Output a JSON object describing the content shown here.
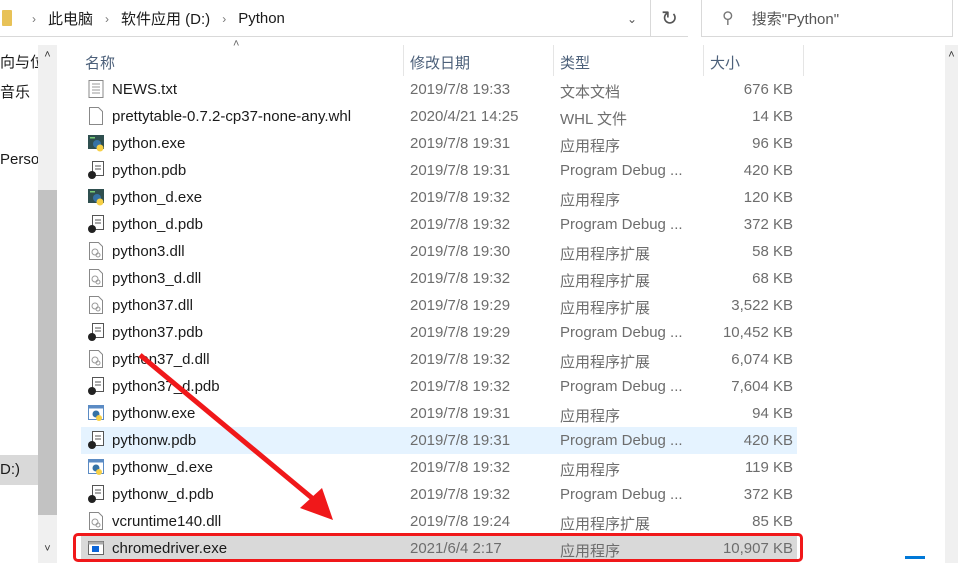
{
  "address": {
    "crumbs": [
      "此电脑",
      "软件应用 (D:)",
      "Python"
    ]
  },
  "search": {
    "placeholder": "搜索\"Python\""
  },
  "sidebar": {
    "items": [
      "向与位",
      "音乐",
      "Perso",
      "D:)"
    ]
  },
  "columns": {
    "name": "名称",
    "date": "修改日期",
    "type": "类型",
    "size": "大小"
  },
  "files": [
    {
      "name": "NEWS.txt",
      "date": "2019/7/8 19:33",
      "type": "文本文档",
      "size": "676 KB",
      "icon": "text-file"
    },
    {
      "name": "prettytable-0.7.2-cp37-none-any.whl",
      "date": "2020/4/21 14:25",
      "type": "WHL 文件",
      "size": "14 KB",
      "icon": "blank-file"
    },
    {
      "name": "python.exe",
      "date": "2019/7/8 19:31",
      "type": "应用程序",
      "size": "96 KB",
      "icon": "python-console"
    },
    {
      "name": "python.pdb",
      "date": "2019/7/8 19:31",
      "type": "Program Debug ...",
      "size": "420 KB",
      "icon": "pdb-file"
    },
    {
      "name": "python_d.exe",
      "date": "2019/7/8 19:32",
      "type": "应用程序",
      "size": "120 KB",
      "icon": "python-console"
    },
    {
      "name": "python_d.pdb",
      "date": "2019/7/8 19:32",
      "type": "Program Debug ...",
      "size": "372 KB",
      "icon": "pdb-file"
    },
    {
      "name": "python3.dll",
      "date": "2019/7/8 19:30",
      "type": "应用程序扩展",
      "size": "58 KB",
      "icon": "dll-file"
    },
    {
      "name": "python3_d.dll",
      "date": "2019/7/8 19:32",
      "type": "应用程序扩展",
      "size": "68 KB",
      "icon": "dll-file"
    },
    {
      "name": "python37.dll",
      "date": "2019/7/8 19:29",
      "type": "应用程序扩展",
      "size": "3,522 KB",
      "icon": "dll-file"
    },
    {
      "name": "python37.pdb",
      "date": "2019/7/8 19:29",
      "type": "Program Debug ...",
      "size": "10,452 KB",
      "icon": "pdb-file"
    },
    {
      "name": "python37_d.dll",
      "date": "2019/7/8 19:32",
      "type": "应用程序扩展",
      "size": "6,074 KB",
      "icon": "dll-file"
    },
    {
      "name": "python37_d.pdb",
      "date": "2019/7/8 19:32",
      "type": "Program Debug ...",
      "size": "7,604 KB",
      "icon": "pdb-file"
    },
    {
      "name": "pythonw.exe",
      "date": "2019/7/8 19:31",
      "type": "应用程序",
      "size": "94 KB",
      "icon": "python-window"
    },
    {
      "name": "pythonw.pdb",
      "date": "2019/7/8 19:31",
      "type": "Program Debug ...",
      "size": "420 KB",
      "icon": "pdb-file"
    },
    {
      "name": "pythonw_d.exe",
      "date": "2019/7/8 19:32",
      "type": "应用程序",
      "size": "119 KB",
      "icon": "python-window"
    },
    {
      "name": "pythonw_d.pdb",
      "date": "2019/7/8 19:32",
      "type": "Program Debug ...",
      "size": "372 KB",
      "icon": "pdb-file"
    },
    {
      "name": "vcruntime140.dll",
      "date": "2019/7/8 19:24",
      "type": "应用程序扩展",
      "size": "85 KB",
      "icon": "dll-file"
    },
    {
      "name": "chromedriver.exe",
      "date": "2021/6/4 2:17",
      "type": "应用程序",
      "size": "10,907 KB",
      "icon": "app-window"
    }
  ],
  "hover_row": 13,
  "selected_row": 17,
  "colors": {
    "highlight": "#f0181a",
    "hover": "#e5f3ff",
    "selected": "#d9d9d9"
  }
}
